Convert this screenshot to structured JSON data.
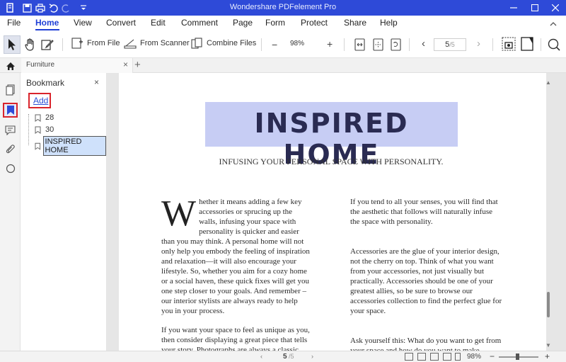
{
  "app": {
    "title": "Wondershare PDFelement Pro",
    "accent_color": "#2e4ad8"
  },
  "quick_access": [
    {
      "name": "logo-icon"
    },
    {
      "name": "save-icon"
    },
    {
      "name": "print-icon"
    },
    {
      "name": "undo-icon"
    },
    {
      "name": "redo-icon"
    },
    {
      "name": "customize-dropdown-icon"
    }
  ],
  "menu": {
    "items": [
      "File",
      "Home",
      "View",
      "Convert",
      "Edit",
      "Comment",
      "Page",
      "Form",
      "Protect",
      "Share",
      "Help"
    ],
    "active": "Home"
  },
  "toolbar": {
    "from_file": "From File",
    "from_scanner": "From Scanner",
    "combine_files": "Combine Files",
    "zoom_value": "98%",
    "zoom_minus": "−",
    "zoom_plus": "+",
    "page_current": "5",
    "page_total": "/5",
    "page_prev": "‹",
    "page_next": "›"
  },
  "tabs": [
    {
      "label": "Furniture",
      "close": "×"
    }
  ],
  "tab_add": "+",
  "panel": {
    "title": "Bookmark",
    "close": "×",
    "add_label": "Add",
    "bookmarks": [
      "28",
      "30",
      "INSPIRED HOME"
    ]
  },
  "document": {
    "headline": "INSPIRED HOME",
    "subhead": "INFUSING YOUR PERSONAL SPACE WITH PERSONALITY.",
    "dropcap": "W",
    "col1_para1": "hether it means adding a few key accessories or sprucing up the walls, infusing your space with personality is quicker and easier than you may think. A personal home will not only help you embody the feeling of inspiration and relaxation—it will also encourage your lifestyle. So, whether you aim for a cozy home or a social haven, these quick fixes will get you one step closer to your goals. And remember – our interior stylists are always ready to help you in your process.",
    "col1_para2": "If you want your space to feel as unique as you, then consider displaying a great piece that tells your story. Photographs are always a classic",
    "col2_para1": "If you tend to all your senses, you will find that the aesthetic that follows will naturally infuse the space with personality.",
    "col2_para2": "Accessories are the glue of your interior design, not the cherry on top. Think of what you want from your accessories, not just visually but practically. Accessories should be one of your greatest allies, so be sure to browse our accessories collection to find the perfect glue for your space.",
    "col2_para3": "Ask yourself this: What do you want to get from your space and how do you want to make"
  },
  "status": {
    "page_current": "5",
    "page_total": "/5",
    "zoom": "98%",
    "zoom_minus": "−",
    "zoom_plus": "+",
    "zoom_fraction": 0.46
  }
}
